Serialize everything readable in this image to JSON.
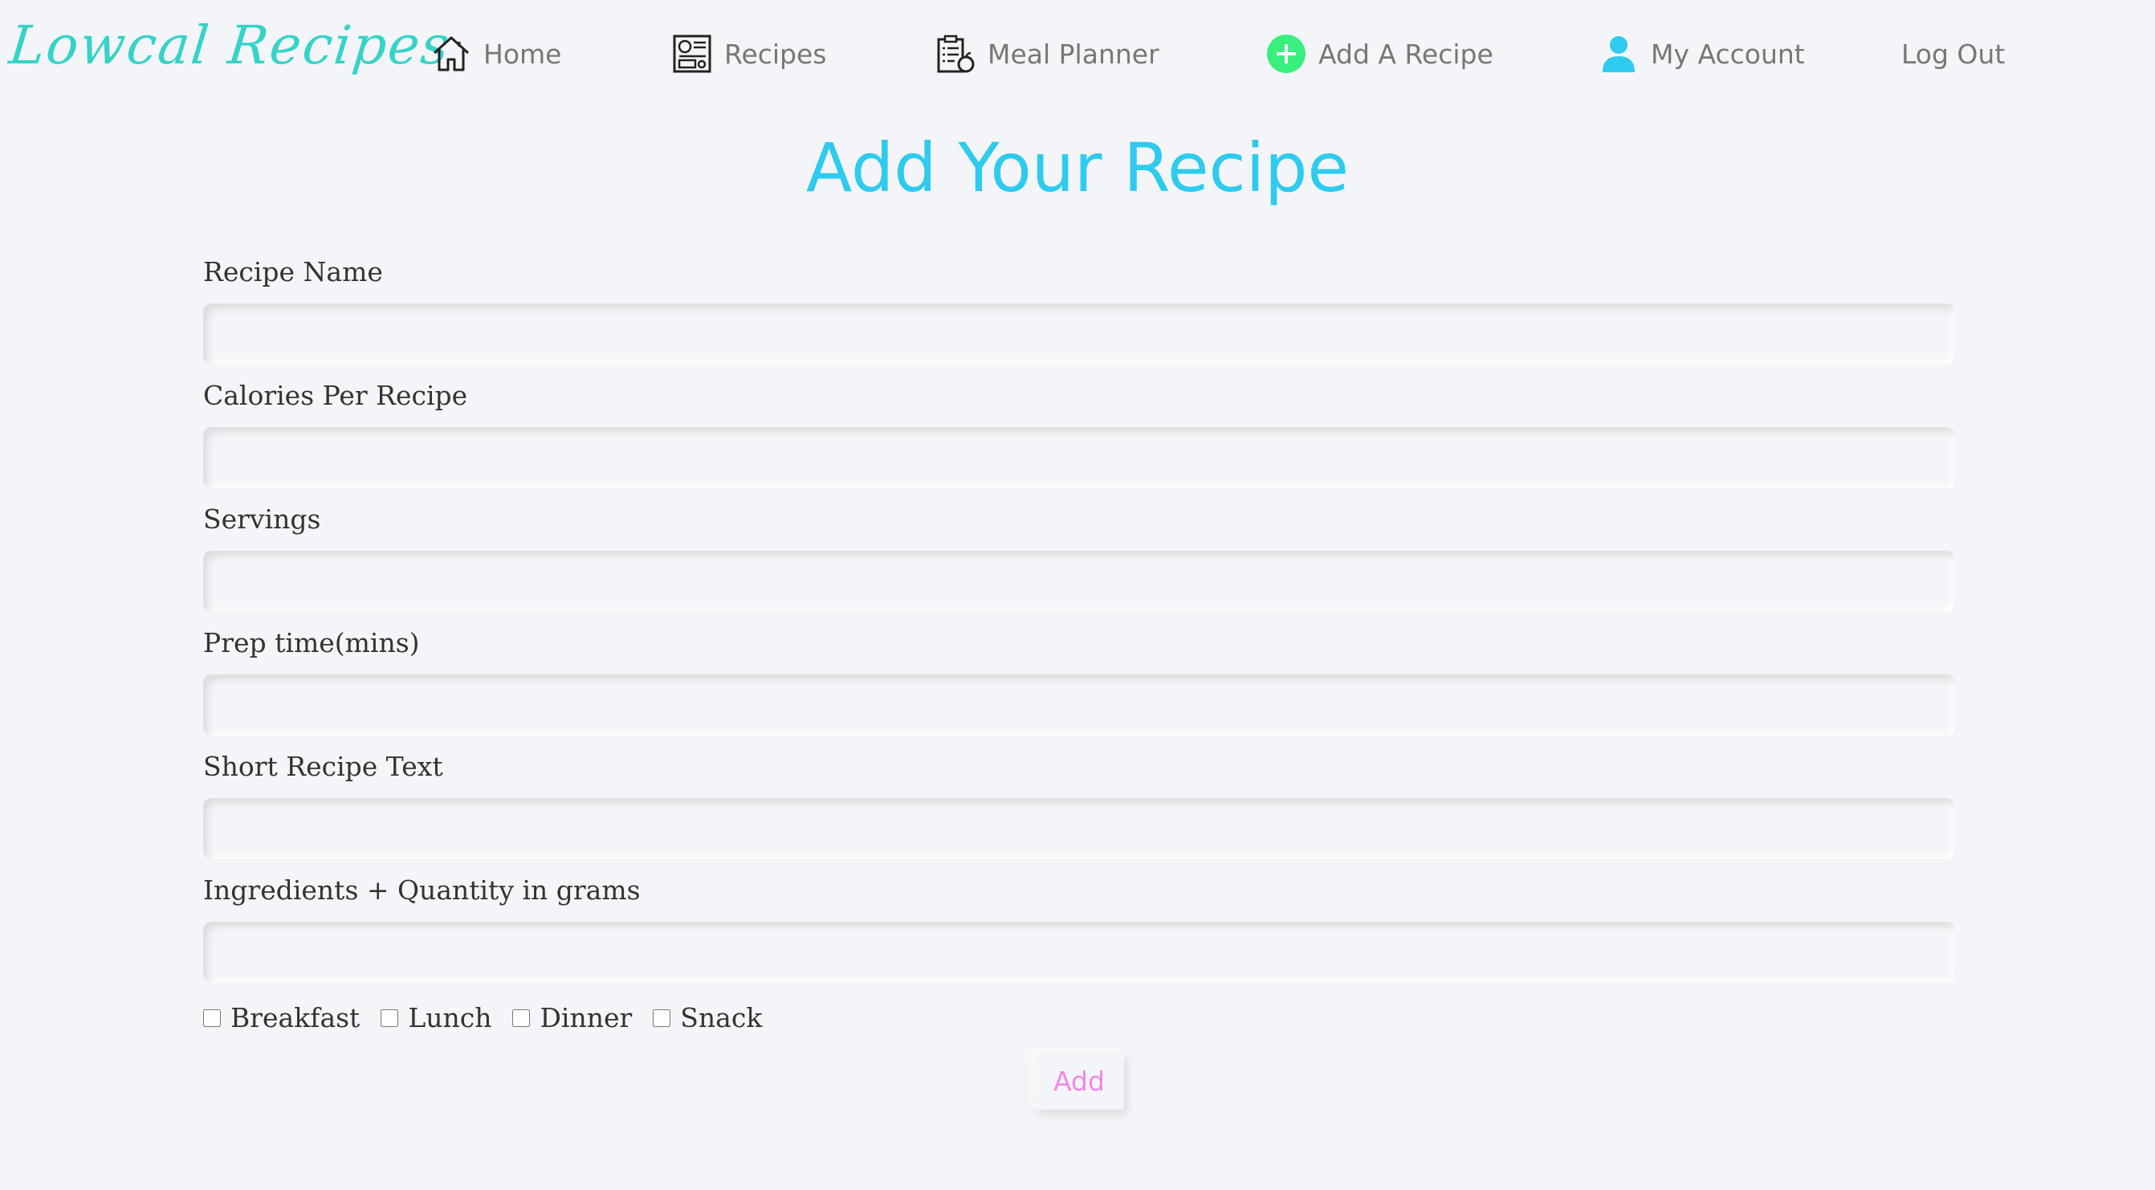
{
  "brand": {
    "logo_text": "Lowcal Recipes",
    "logo_color": "#36d3c9"
  },
  "nav": {
    "home": {
      "label": "Home",
      "icon": "home-icon"
    },
    "recipes": {
      "label": "Recipes",
      "icon": "recipes-icon"
    },
    "meal_planner": {
      "label": "Meal Planner",
      "icon": "meal-planner-icon"
    },
    "add_recipe": {
      "label": "Add A Recipe",
      "icon": "plus-circle-icon",
      "icon_color": "#39ef7e"
    },
    "my_account": {
      "label": "My Account",
      "icon": "user-icon",
      "icon_color": "#2ecbee"
    },
    "logout": {
      "label": "Log Out"
    }
  },
  "page": {
    "title": "Add Your Recipe",
    "title_color": "#2ecbee"
  },
  "form": {
    "fields": [
      {
        "label": "Recipe Name",
        "value": "",
        "placeholder": ""
      },
      {
        "label": "Calories Per Recipe",
        "value": "",
        "placeholder": ""
      },
      {
        "label": "Servings",
        "value": "",
        "placeholder": ""
      },
      {
        "label": "Prep time(mins)",
        "value": "",
        "placeholder": ""
      },
      {
        "label": "Short Recipe Text",
        "value": "",
        "placeholder": ""
      },
      {
        "label": "Ingredients + Quantity in grams",
        "value": "",
        "placeholder": ""
      }
    ],
    "meal_types": [
      {
        "label": "Breakfast",
        "checked": false
      },
      {
        "label": "Lunch",
        "checked": false
      },
      {
        "label": "Dinner",
        "checked": false
      },
      {
        "label": "Snack",
        "checked": false
      }
    ],
    "submit_label": "Add",
    "submit_color": "#f386e8"
  }
}
